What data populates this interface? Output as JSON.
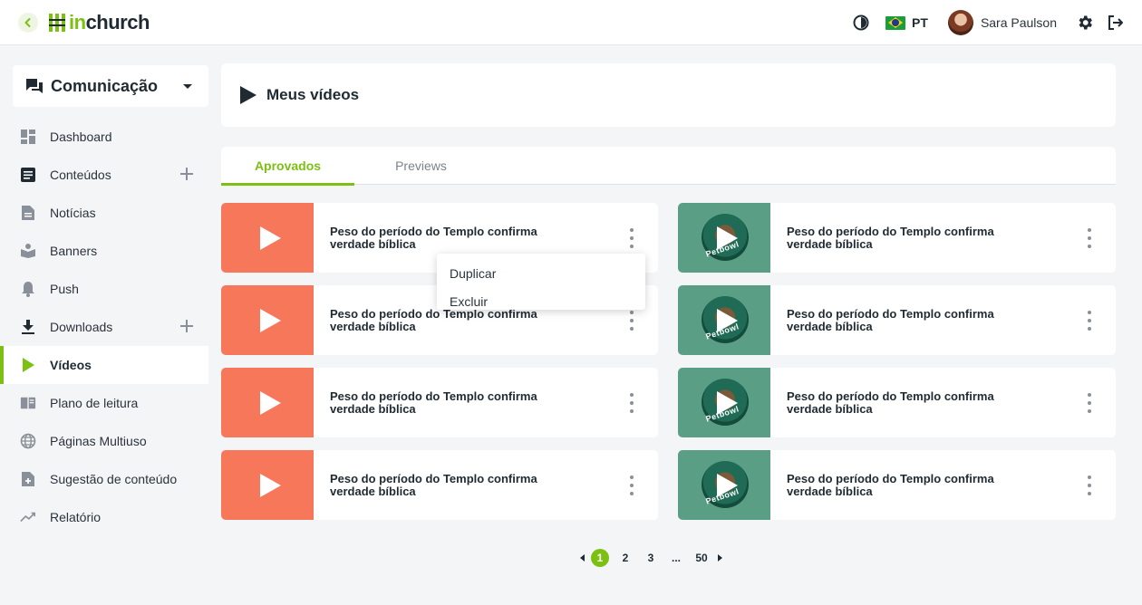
{
  "colors": {
    "accent": "#7cc111",
    "thumb_orange": "#f7775a",
    "thumb_green": "#5a9e86"
  },
  "header": {
    "logo_in": "in",
    "logo_church": "church",
    "language": "PT",
    "user_name": "Sara Paulson"
  },
  "sidebar": {
    "module": "Comunicação",
    "items": [
      {
        "label": "Dashboard",
        "icon": "dashboard-icon"
      },
      {
        "label": "Conteúdos",
        "icon": "article-icon"
      },
      {
        "label": "Notícias",
        "icon": "news-icon"
      },
      {
        "label": "Banners",
        "icon": "banner-icon"
      },
      {
        "label": "Push",
        "icon": "bell-icon"
      },
      {
        "label": "Downloads",
        "icon": "download-icon"
      },
      {
        "label": "Vídeos",
        "icon": "play-icon"
      },
      {
        "label": "Plano de leitura",
        "icon": "book-icon"
      },
      {
        "label": "Páginas Multiuso",
        "icon": "globe-icon"
      },
      {
        "label": "Sugestão de conteúdo",
        "icon": "file-plus-icon"
      },
      {
        "label": "Relatório",
        "icon": "trending-icon"
      }
    ]
  },
  "main": {
    "title": "Meus vídeos",
    "tabs": [
      {
        "label": "Aprovados"
      },
      {
        "label": "Previews"
      }
    ],
    "videos": [
      {
        "title": "Peso do período do Templo confirma verdade bíblica",
        "thumb": "orange"
      },
      {
        "title": "Peso do período do Templo confirma verdade bíblica",
        "thumb": "green",
        "thumb_text": "Petbowl"
      },
      {
        "title": "Peso do período do Templo confirma verdade bíblica",
        "thumb": "orange"
      },
      {
        "title": "Peso do período do Templo confirma verdade bíblica",
        "thumb": "green",
        "thumb_text": "Petbowl"
      },
      {
        "title": "Peso do período do Templo confirma verdade bíblica",
        "thumb": "orange"
      },
      {
        "title": "Peso do período do Templo confirma verdade bíblica",
        "thumb": "green",
        "thumb_text": "Petbowl"
      },
      {
        "title": "Peso do período do Templo confirma verdade bíblica",
        "thumb": "orange"
      },
      {
        "title": "Peso do período do Templo confirma verdade bíblica",
        "thumb": "green",
        "thumb_text": "Petbowl"
      }
    ],
    "menu": {
      "items": [
        "Duplicar",
        "Excluir"
      ]
    }
  },
  "pagination": {
    "pages": [
      "1",
      "2",
      "3",
      "...",
      "50"
    ],
    "current": "1"
  }
}
